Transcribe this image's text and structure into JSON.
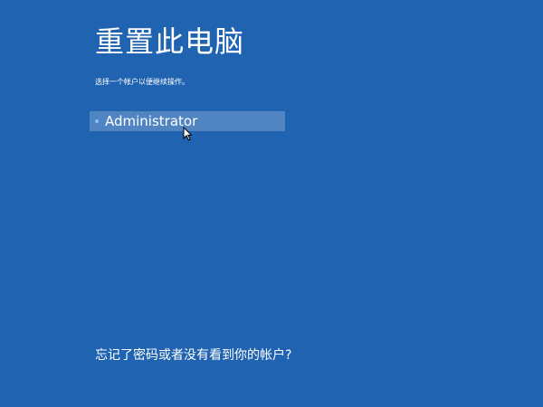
{
  "colors": {
    "background": "#1f63b1",
    "text": "#ffffff",
    "selected_item_background": "rgba(255,255,255,0.22)",
    "bullet": "#7fc6ff"
  },
  "page": {
    "title": "重置此电脑",
    "subtitle": "选择一个帐户以便继续操作。"
  },
  "accounts": [
    {
      "name": "Administrator",
      "icon": "bullet-icon"
    }
  ],
  "footer": {
    "forgot_link": "忘记了密码或者没有看到你的帐户?"
  },
  "cursor": {
    "icon": "mouse-pointer-icon"
  }
}
